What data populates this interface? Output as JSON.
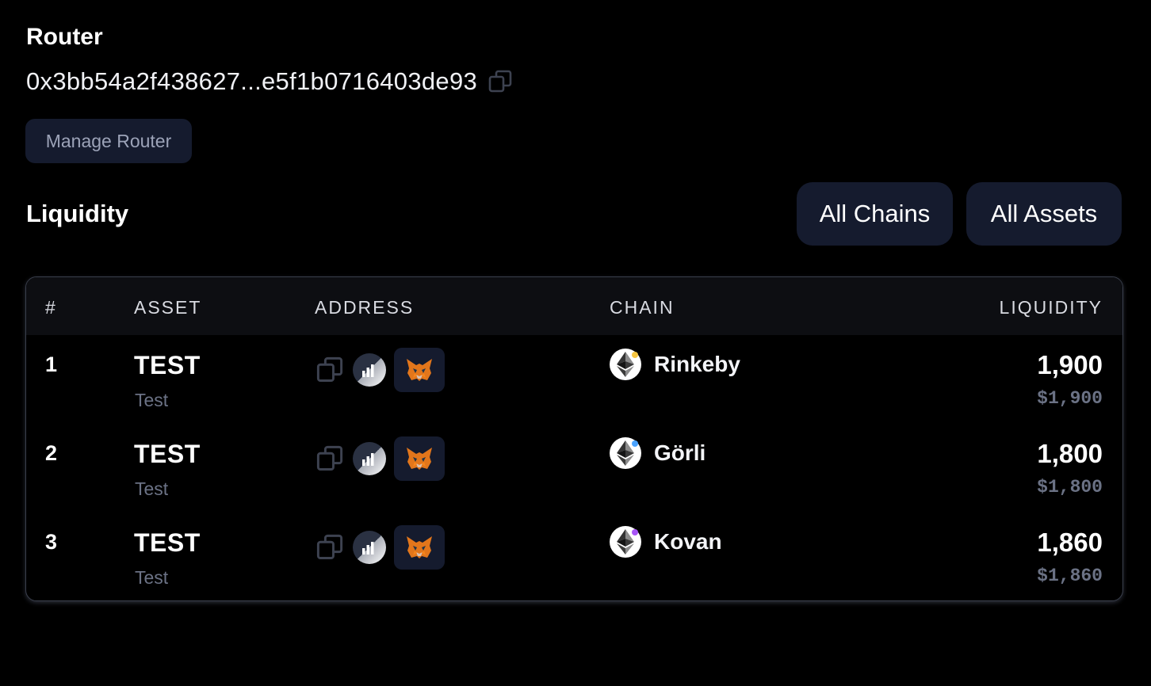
{
  "router": {
    "title": "Router",
    "address": "0x3bb54a2f438627...e5f1b0716403de93",
    "copy_icon": "copy-icon",
    "manage_label": "Manage Router"
  },
  "liquidity": {
    "title": "Liquidity",
    "filters": {
      "chains": "All Chains",
      "assets": "All Assets"
    },
    "table": {
      "headers": {
        "num": "#",
        "asset": "ASSET",
        "address": "ADDRESS",
        "chain": "CHAIN",
        "liquidity": "LIQUIDITY"
      },
      "rows": [
        {
          "num": "1",
          "symbol": "TEST",
          "name": "Test",
          "chain": "Rinkeby",
          "chain_dot_color": "#f5c542",
          "amount": "1,900",
          "usd": "$1,900"
        },
        {
          "num": "2",
          "symbol": "TEST",
          "name": "Test",
          "chain": "Görli",
          "chain_dot_color": "#4aa3ff",
          "amount": "1,800",
          "usd": "$1,800"
        },
        {
          "num": "3",
          "symbol": "TEST",
          "name": "Test",
          "chain": "Kovan",
          "chain_dot_color": "#a855f7",
          "amount": "1,860",
          "usd": "$1,860"
        }
      ]
    }
  },
  "icons": {
    "copy": "copy-icon",
    "explorer": "block-explorer-icon",
    "metamask": "metamask-fox-icon",
    "chain": "ethereum-icon"
  },
  "colors": {
    "background": "#000000",
    "button_bg": "#151b2e",
    "muted_text": "#6b7285"
  }
}
